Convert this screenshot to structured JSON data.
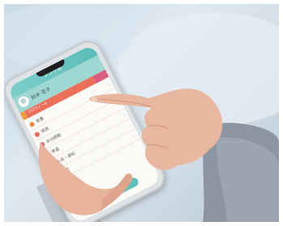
{
  "app": {
    "title": "アプリ名",
    "profile_name": "鈴木 花子",
    "tabs": [
      "プロフィール",
      "",
      ""
    ],
    "items": [
      {
        "label": "食事",
        "color": "#f08a3c"
      },
      {
        "label": "排泄",
        "color": "#e96b5a"
      },
      {
        "label": "水分摂取",
        "color": "#e2607d"
      },
      {
        "label": "体温",
        "color": "#7a8fd0"
      },
      {
        "label": "入浴・清拭",
        "color": "#5bb8c6"
      },
      {
        "label": "口腔",
        "color": "#7cc46a"
      }
    ],
    "button_label": "登録する"
  },
  "colors": {
    "accent": "#5fc1bd",
    "skin": "#e9b79f"
  }
}
